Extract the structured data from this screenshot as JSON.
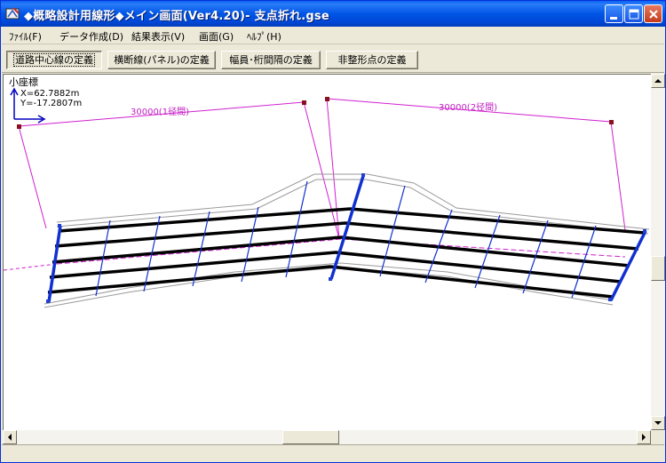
{
  "window": {
    "title": "◆概略設計用線形◆メイン画面(Ver4.20)- 支点折れ.gse"
  },
  "menu": [
    {
      "label": "ﾌｧｲﾙ(F)"
    },
    {
      "label": "データ作成(D)"
    },
    {
      "label": "結果表示(V)"
    },
    {
      "label": "画面(G)"
    },
    {
      "label": "ﾍﾙﾌﾟ(H)"
    }
  ],
  "toolbar": [
    {
      "label": "道路中心線の定義",
      "active": true
    },
    {
      "label": "横断線(パネル)の定義",
      "active": false
    },
    {
      "label": "幅員･桁間隔の定義",
      "active": false
    },
    {
      "label": "非整形点の定義",
      "active": false
    }
  ],
  "canvas": {
    "coord_title": "小座標",
    "coord_x": "X=62.7882m",
    "coord_y": "Y=-17.2807m",
    "span1_label": "30000(1径間)",
    "span2_label": "30000(2径間)"
  },
  "colors": {
    "title_blue": "#0055e5",
    "span_magenta": "#d020d0",
    "girder_black": "#000000",
    "crossbeam_blue": "#1030d0",
    "outline_gray": "#9a9a9a"
  }
}
